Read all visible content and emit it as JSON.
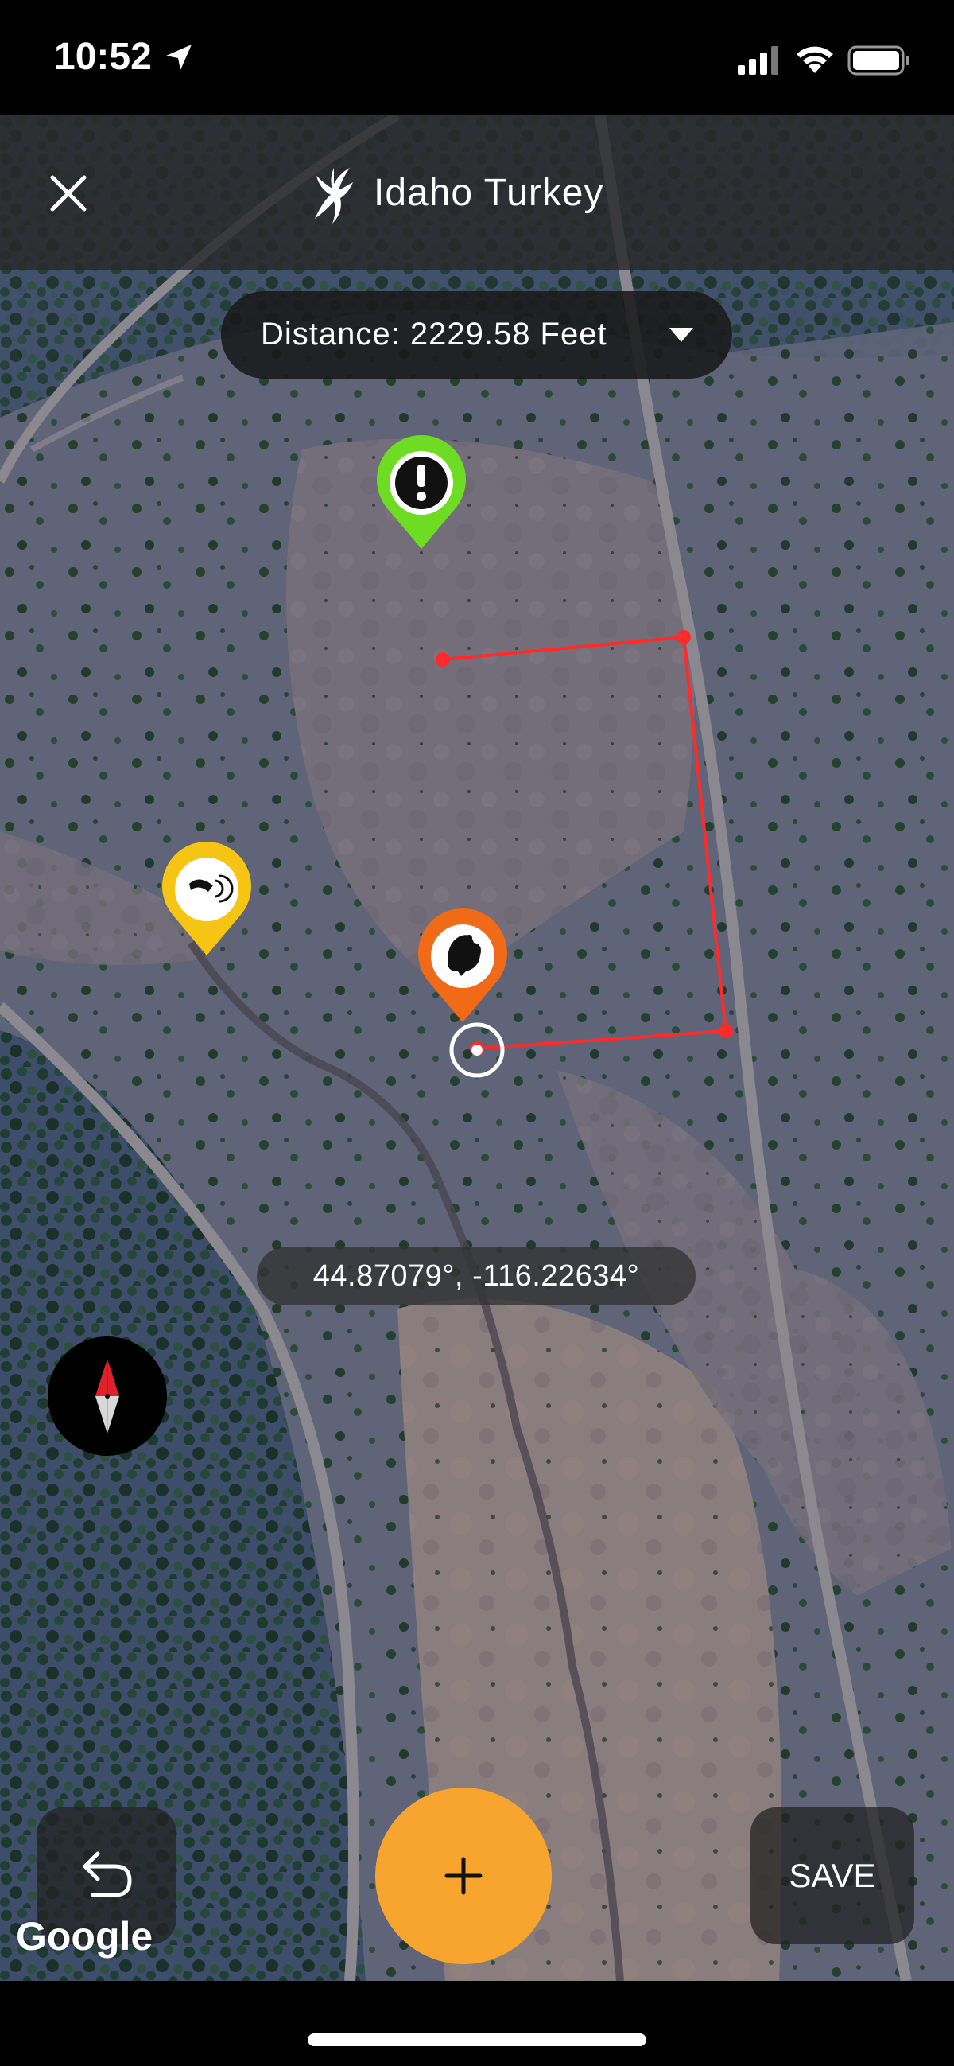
{
  "status_bar": {
    "time": "10:52",
    "icons": [
      "location-arrow-icon",
      "signal-icon",
      "wifi-icon",
      "battery-icon"
    ]
  },
  "header": {
    "title": "Idaho Turkey",
    "close_icon": "close-icon",
    "brand_icon": "brand-icon"
  },
  "distance": {
    "label": "Distance: 2229.58 Feet",
    "icon": "chevron-down-icon"
  },
  "coordinates": "44.87079°, -116.22634°",
  "markers": [
    {
      "name": "alert-marker",
      "color": "#6ddc22",
      "icon": "exclamation-icon"
    },
    {
      "name": "call-marker",
      "color": "#f6c514",
      "icon": "turkey-call-icon"
    },
    {
      "name": "turkey-marker",
      "color": "#f06a18",
      "icon": "turkey-icon"
    }
  ],
  "measure_line_color": "#ff2a2a",
  "controls": {
    "undo_icon": "undo-icon",
    "add_icon": "plus-icon",
    "save_label": "SAVE",
    "compass_icon": "compass-icon"
  },
  "attribution": "Google",
  "colors": {
    "accent": "#f8a530",
    "header_bg": "#282828"
  }
}
